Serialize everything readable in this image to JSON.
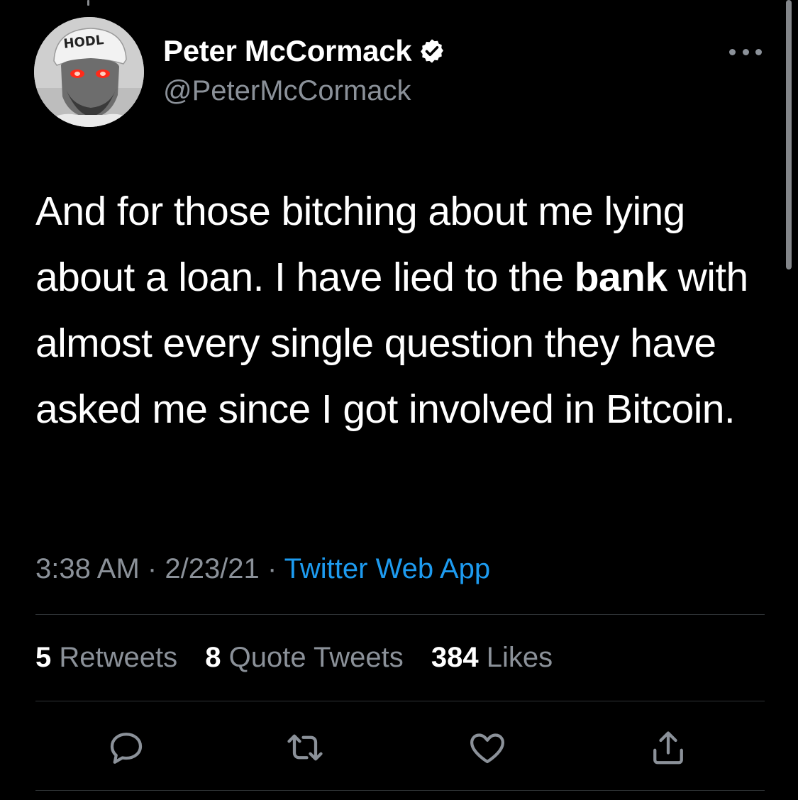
{
  "author": {
    "display_name": "Peter McCormack",
    "handle": "@PeterMcCormack",
    "verified": true,
    "avatar_cap_text": "HODL"
  },
  "tweet": {
    "text_before_bold": "And for those bitching about me lying about a loan. I have lied to the ",
    "text_bold": "bank",
    "text_after_bold": " with almost every single question they have asked me since I got involved in Bitcoin."
  },
  "meta": {
    "time": "3:38 AM",
    "separator": "·",
    "date": "2/23/21",
    "source": "Twitter Web App"
  },
  "stats": {
    "retweets_count": "5",
    "retweets_label": "Retweets",
    "quotes_count": "8",
    "quotes_label": "Quote Tweets",
    "likes_count": "384",
    "likes_label": "Likes"
  },
  "actions": [
    "reply-icon",
    "retweet-icon",
    "like-icon",
    "share-icon"
  ],
  "colors": {
    "background": "#000000",
    "text_primary": "#ffffff",
    "text_secondary": "#8b9199",
    "link": "#1d9bf0",
    "divider": "#2f3336"
  }
}
